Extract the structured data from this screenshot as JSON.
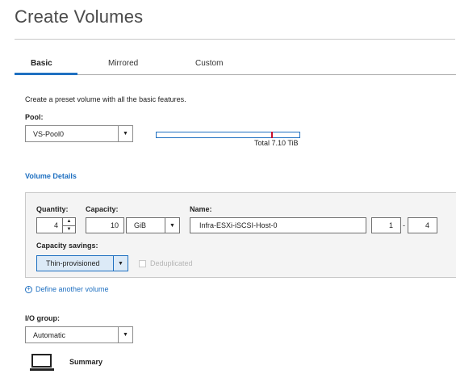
{
  "title": "Create Volumes",
  "tabs": [
    {
      "label": "Basic",
      "active": true
    },
    {
      "label": "Mirrored",
      "active": false
    },
    {
      "label": "Custom",
      "active": false
    }
  ],
  "description": "Create a preset volume with all the basic features.",
  "pool": {
    "label": "Pool:",
    "value": "VS-Pool0",
    "capacity_total": "Total 7.10 TiB",
    "used_fraction": 0.8
  },
  "volume_details": {
    "title": "Volume Details",
    "quantity": {
      "label": "Quantity:",
      "value": "4"
    },
    "capacity": {
      "label": "Capacity:",
      "value": "10",
      "unit": "GiB"
    },
    "name": {
      "label": "Name:",
      "value": "Infra-ESXi-iSCSI-Host-0",
      "range_start": "1",
      "range_sep": "-",
      "range_end": "4"
    },
    "capacity_savings": {
      "label": "Capacity savings:",
      "value": "Thin-provisioned"
    },
    "deduplicated": {
      "label": "Deduplicated",
      "checked": false,
      "enabled": false
    }
  },
  "define_another": "Define another volume",
  "io_group": {
    "label": "I/O group:",
    "value": "Automatic"
  },
  "summary_label": "Summary",
  "colors": {
    "accent": "#1f70c1",
    "marker": "#c8102e"
  }
}
